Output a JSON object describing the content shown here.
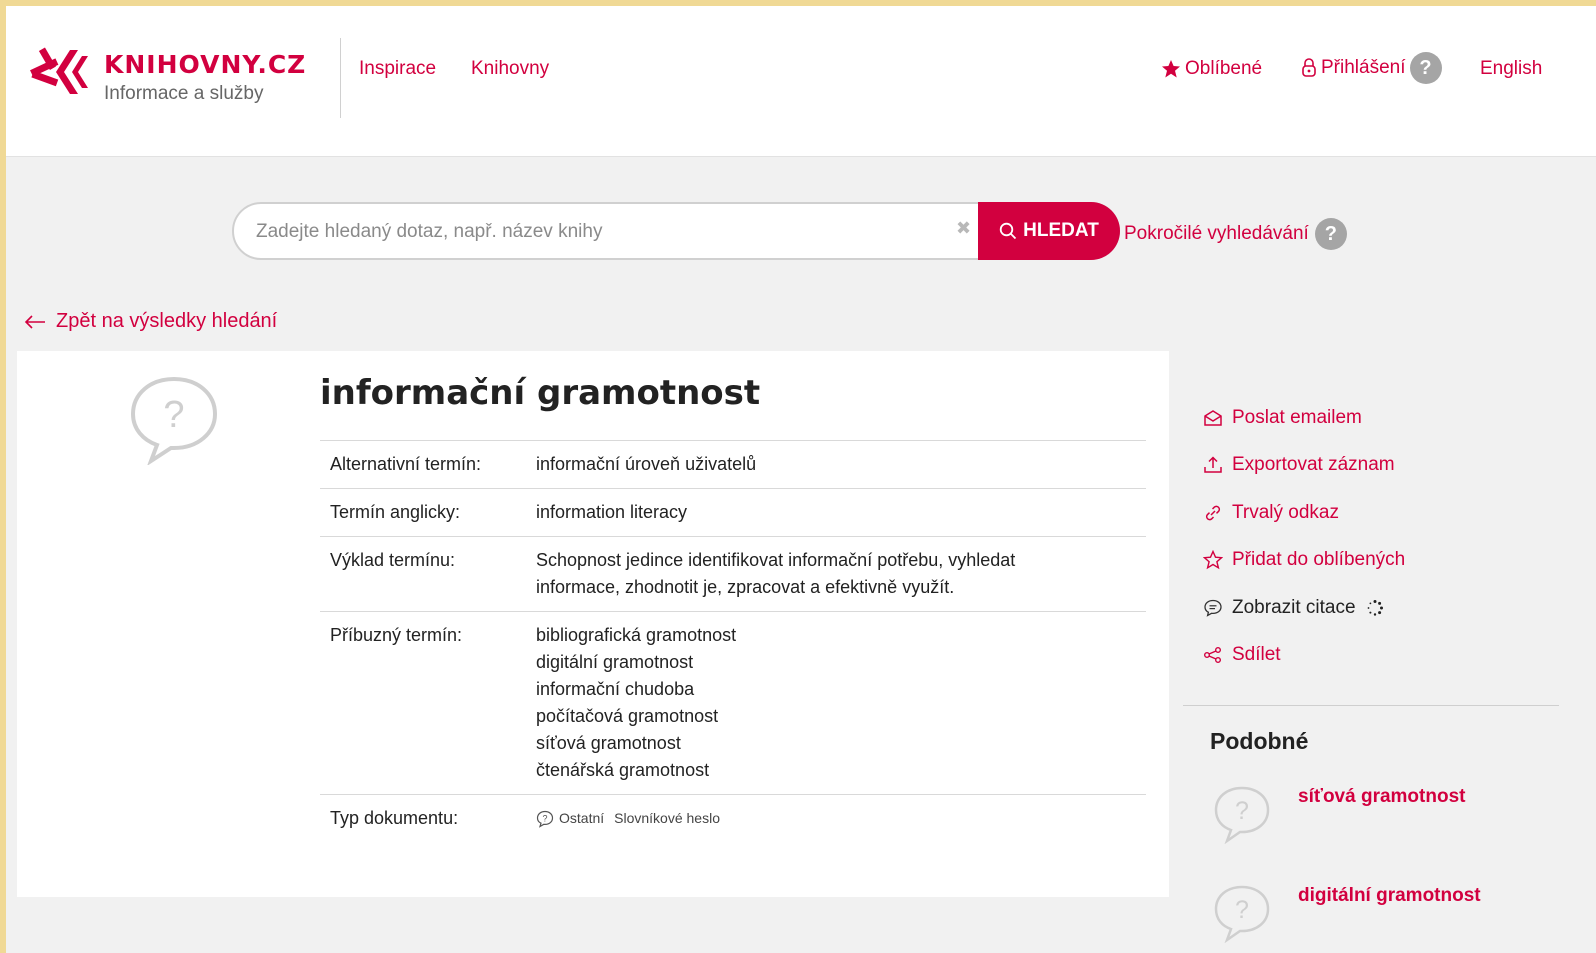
{
  "brand": {
    "name": "KNIHOVNY.CZ",
    "tagline": "Informace a služby",
    "color": "#d2003f"
  },
  "nav": {
    "links": [
      "Inspirace",
      "Knihovny"
    ],
    "favorites": "Oblíbené",
    "login": "Přihlášení",
    "help": "?",
    "language": "English"
  },
  "search": {
    "placeholder": "Zadejte hledaný dotaz, např. název knihy",
    "value": "",
    "button": "HLEDAT",
    "advanced": "Pokročilé vyhledávání"
  },
  "back_link": "Zpět na výsledky hledání",
  "record": {
    "title": "informační gramotnost",
    "fields": [
      {
        "label": "Alternativní termín:",
        "value": "informační úroveň uživatelů"
      },
      {
        "label": "Termín anglicky:",
        "value": "information literacy"
      },
      {
        "label": "Výklad termínu:",
        "value": "Schopnost jedince identifikovat informační potřebu, vyhledat informace, zhodnotit je, zpracovat a efektivně využít."
      },
      {
        "label": "Příbuzný termín:",
        "values": [
          "bibliografická gramotnost",
          "digitální gramotnost",
          "informační chudoba",
          "počítačová gramotnost",
          "síťová gramotnost",
          "čtenářská gramotnost"
        ]
      },
      {
        "label": "Typ dokumentu:",
        "type": "Ostatní",
        "subtype": "Slovníkové heslo"
      }
    ]
  },
  "actions": [
    {
      "label": "Poslat emailem",
      "icon": "envelope-icon"
    },
    {
      "label": "Exportovat záznam",
      "icon": "export-icon"
    },
    {
      "label": "Trvalý odkaz",
      "icon": "link-icon"
    },
    {
      "label": "Přidat do oblíbených",
      "icon": "star-outline-icon"
    },
    {
      "label": "Zobrazit citace",
      "icon": "quote-bubble-icon"
    },
    {
      "label": "Sdílet",
      "icon": "share-icon"
    }
  ],
  "similar": {
    "title": "Podobné",
    "items": [
      "síťová gramotnost",
      "digitální gramotnost"
    ]
  }
}
